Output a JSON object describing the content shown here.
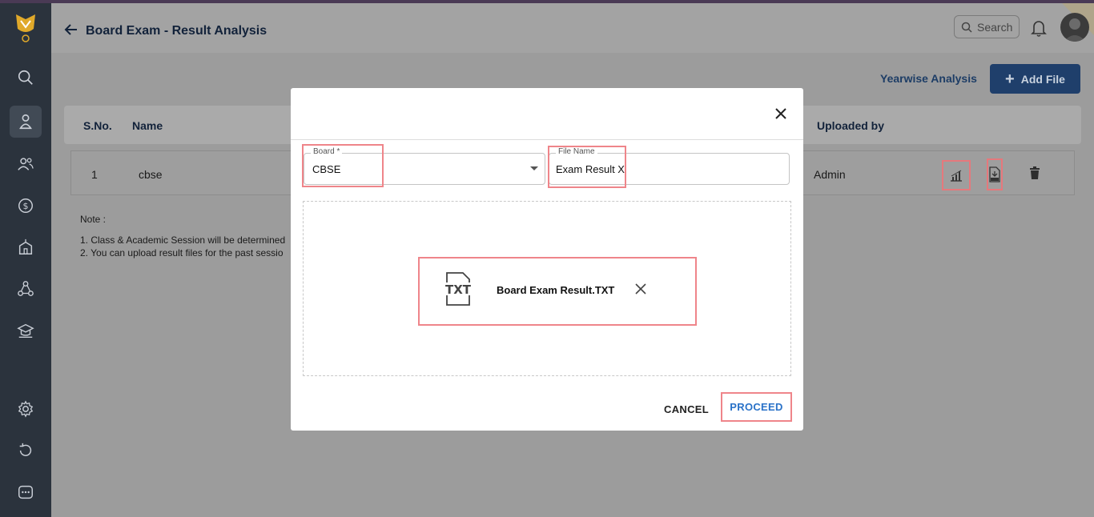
{
  "header": {
    "title": "Board Exam - Result Analysis",
    "search_placeholder": "Search"
  },
  "sidebar": {
    "items": [
      {
        "icon": "search-icon"
      },
      {
        "icon": "exam-icon",
        "active": true
      },
      {
        "icon": "users-icon"
      },
      {
        "icon": "dollar-icon"
      },
      {
        "icon": "school-icon"
      },
      {
        "icon": "network-icon"
      },
      {
        "icon": "graduation-cap-icon"
      },
      {
        "icon": "gear-icon"
      },
      {
        "icon": "refresh-icon"
      },
      {
        "icon": "more-icon"
      }
    ]
  },
  "toolbar": {
    "yearwise_label": "Yearwise Analysis",
    "add_file_label": "Add File"
  },
  "table": {
    "columns": [
      "S.No.",
      "Name",
      "Uploaded by"
    ],
    "rows": [
      {
        "sno": "1",
        "name": "cbse",
        "uploaded_by": "Admin"
      }
    ]
  },
  "note": {
    "title": "Note :",
    "line1": "1. Class & Academic Session will be determined",
    "line2": "2. You can upload result files for the past sessio"
  },
  "modal": {
    "board_label": "Board *",
    "board_value": "CBSE",
    "file_name_label": "File Name",
    "file_name_value": "Exam Result X",
    "file_chip_name": "Board Exam Result.TXT",
    "file_type": "TXT",
    "cancel_label": "CANCEL",
    "proceed_label": "PROCEED"
  },
  "colors": {
    "sidebar": "#2b333d",
    "primary_button": "#1f3f6b",
    "highlight": "#ef858a",
    "proceed_text": "#2a72c8"
  }
}
